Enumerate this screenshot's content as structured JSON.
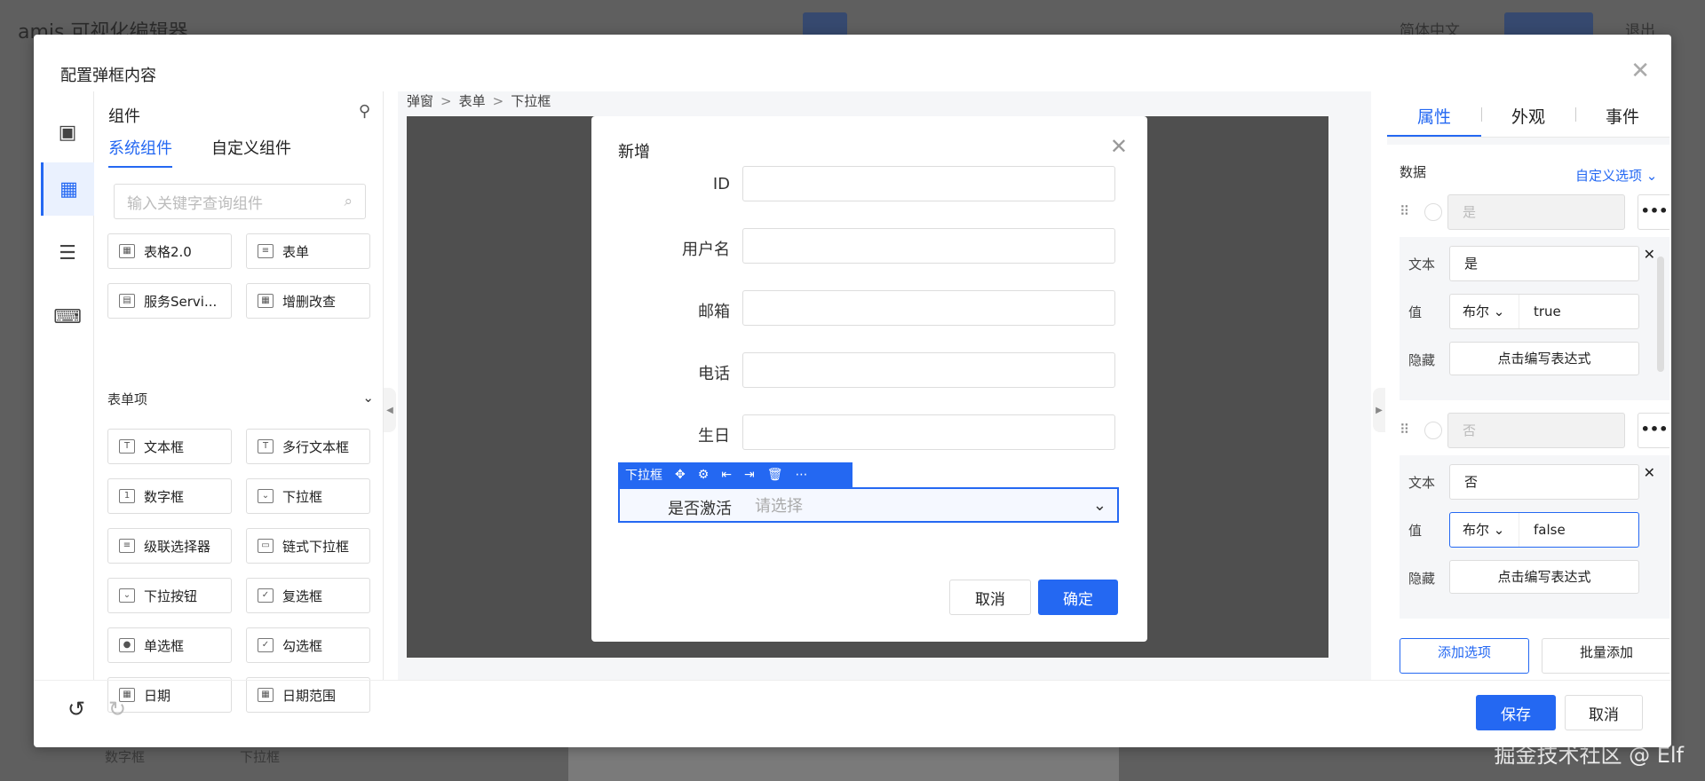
{
  "background": {
    "title": "amis 可视化编辑器",
    "lang": "简体中文",
    "exit": "退出",
    "footer_items": [
      "数字框",
      "下拉框"
    ],
    "watermark": "掘金技术社区 @ Elf"
  },
  "modal": {
    "title": "配置弹框内容",
    "close_icon": "close-icon"
  },
  "component_panel": {
    "title": "组件",
    "tabs": [
      "系统组件",
      "自定义组件"
    ],
    "search_placeholder": "输入关键字查询组件",
    "top_items": [
      {
        "label": "表格2.0",
        "icon": "table-icon"
      },
      {
        "label": "表单",
        "icon": "form-icon"
      },
      {
        "label": "服务Servi...",
        "icon": "service-icon"
      },
      {
        "label": "增删改查",
        "icon": "crud-icon"
      }
    ],
    "section": "表单项",
    "form_items": [
      {
        "label": "文本框",
        "icon": "text-icon",
        "glyph": "T"
      },
      {
        "label": "多行文本框",
        "icon": "textarea-icon",
        "glyph": "T"
      },
      {
        "label": "数字框",
        "icon": "number-icon",
        "glyph": "1"
      },
      {
        "label": "下拉框",
        "icon": "select-icon",
        "glyph": "⌄"
      },
      {
        "label": "级联选择器",
        "icon": "cascader-icon",
        "glyph": "≡"
      },
      {
        "label": "链式下拉框",
        "icon": "chained-select-icon",
        "glyph": "▭"
      },
      {
        "label": "下拉按钮",
        "icon": "dropdown-button-icon",
        "glyph": "⌄"
      },
      {
        "label": "复选框",
        "icon": "checkbox-icon",
        "glyph": "✓"
      },
      {
        "label": "单选框",
        "icon": "radio-icon",
        "glyph": "●"
      },
      {
        "label": "勾选框",
        "icon": "checkmark-icon",
        "glyph": "✓"
      },
      {
        "label": "日期",
        "icon": "date-icon",
        "glyph": "▦"
      },
      {
        "label": "日期范围",
        "icon": "date-range-icon",
        "glyph": "▦"
      }
    ]
  },
  "breadcrumb": [
    "弹窗",
    "表单",
    "下拉框"
  ],
  "dialog": {
    "title": "新增",
    "fields": [
      "ID",
      "用户名",
      "邮箱",
      "电话",
      "生日"
    ],
    "selected_toolbar_label": "下拉框",
    "selected_field_label": "是否激活",
    "selected_placeholder": "请选择",
    "cancel": "取消",
    "confirm": "确定"
  },
  "props_panel": {
    "tabs": [
      "属性",
      "外观",
      "事件"
    ],
    "section": "数据",
    "option_mode": "自定义选项",
    "options": [
      {
        "preview": "是",
        "text_label": "文本",
        "text": "是",
        "value_label": "值",
        "value_type": "布尔",
        "value": "true",
        "hidden_label": "隐藏",
        "hidden_btn": "点击编写表达式"
      },
      {
        "preview": "否",
        "text_label": "文本",
        "text": "否",
        "value_label": "值",
        "value_type": "布尔",
        "value": "false",
        "hidden_label": "隐藏",
        "hidden_btn": "点击编写表达式"
      }
    ],
    "add_option": "添加选项",
    "batch_add": "批量添加"
  },
  "footer": {
    "save": "保存",
    "cancel": "取消"
  },
  "colors": {
    "accent": "#2468f2",
    "stage": "#4f4f4f"
  }
}
